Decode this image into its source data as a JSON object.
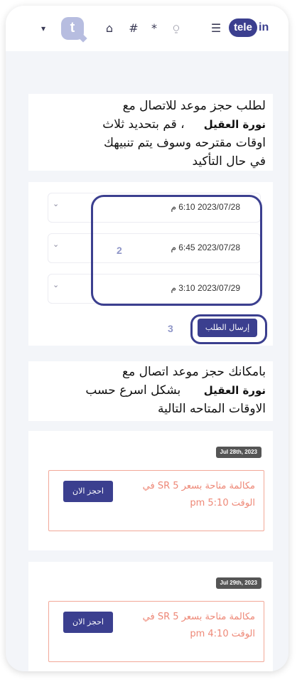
{
  "header": {
    "logo_tele": "tele",
    "logo_in": "in",
    "avatar_letter": "t",
    "icons": [
      "caret-down-icon",
      "home-icon",
      "hash-icon",
      "asterisk-icon",
      "bell-icon",
      "menu-icon"
    ],
    "caret": "▾",
    "home": "⌂",
    "hash": "#",
    "asterisk": "*",
    "bell": "⍜",
    "menu": "☰"
  },
  "request": {
    "line1": "لطلب حجز موعد للاتصال مع",
    "name": "نورة العقيل",
    "line2_rest": "، قم بتحديد ثلاث",
    "line3": "اوقات مقترحه وسوف يتم تنبيهك",
    "line4": "في حال التأكيد"
  },
  "slots_select": [
    {
      "value": "2023/07/28 6:10 م"
    },
    {
      "value": "2023/07/28 6:45 م"
    },
    {
      "value": "2023/07/29 3:10 م"
    }
  ],
  "annotations": {
    "n2": "2",
    "n3": "3"
  },
  "send_label": "إرسال الطلب",
  "fast": {
    "line1": "بامكانك حجز موعد اتصال مع",
    "name": "نورة العقيل",
    "line2_rest": "بشكل اسرع حسب",
    "line3": "الاوقات المتاحه التالية"
  },
  "available": [
    {
      "date": "Jul 28th, 2023",
      "text1": "مكالمة متاحة بسعر 5 SR في",
      "text2": "الوقت 5:10 pm",
      "button": "احجز الان"
    },
    {
      "date": "Jul 29th, 2023",
      "text1": "مكالمة متاحة بسعر 5 SR في",
      "text2": "الوقت 4:10 pm",
      "button": "احجز الان"
    }
  ],
  "colors": {
    "accent": "#3b3f8f",
    "slot_border": "#f2a898",
    "slot_text": "#ee8877"
  }
}
